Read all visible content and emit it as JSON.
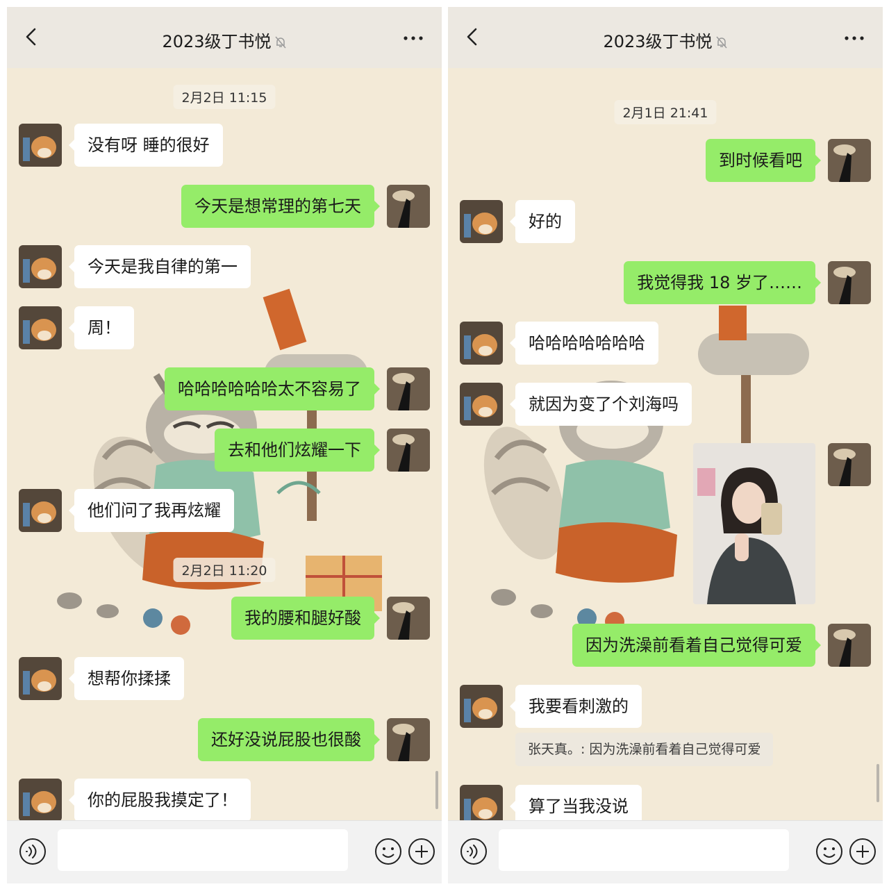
{
  "colors": {
    "chat_background": "#f3ead7",
    "header_background": "#ece8e1",
    "sent_bubble": "#95ec69",
    "received_bubble": "#ffffff"
  },
  "icons": {
    "back": "chevron-left-icon",
    "muted": "bell-slash-icon",
    "more": "ellipsis-icon",
    "voice": "voice-input-icon",
    "emoji": "emoji-icon",
    "plus": "plus-circle-icon"
  },
  "left": {
    "header": {
      "title": "2023级丁书悦"
    },
    "messages": [
      {
        "kind": "time",
        "text": "2月2日 11:15"
      },
      {
        "kind": "in",
        "text": "没有呀 睡的很好"
      },
      {
        "kind": "out",
        "text": "今天是想常理的第七天"
      },
      {
        "kind": "in",
        "text": "今天是我自律的第一"
      },
      {
        "kind": "in",
        "text": "周！"
      },
      {
        "kind": "out",
        "text": "哈哈哈哈哈哈太不容易了"
      },
      {
        "kind": "out",
        "text": "去和他们炫耀一下"
      },
      {
        "kind": "in",
        "text": "他们问了我再炫耀"
      },
      {
        "kind": "time",
        "text": "2月2日 11:20"
      },
      {
        "kind": "out",
        "text": "我的腰和腿好酸"
      },
      {
        "kind": "in",
        "text": "想帮你揉揉"
      },
      {
        "kind": "out",
        "text": "还好没说屁股也很酸"
      },
      {
        "kind": "in",
        "text": "你的屁股我摸定了！"
      }
    ]
  },
  "right": {
    "header": {
      "title": "2023级丁书悦"
    },
    "messages": [
      {
        "kind": "time",
        "text": "2月1日 21:41"
      },
      {
        "kind": "out",
        "text": "到时候看吧"
      },
      {
        "kind": "in",
        "text": "好的"
      },
      {
        "kind": "out",
        "text": "我觉得我 18 岁了……"
      },
      {
        "kind": "in",
        "text": "哈哈哈哈哈哈哈"
      },
      {
        "kind": "in",
        "text": "就因为变了个刘海吗"
      },
      {
        "kind": "out_image",
        "text": ""
      },
      {
        "kind": "out",
        "text": "因为洗澡前看着自己觉得可爱"
      },
      {
        "kind": "in",
        "text": "我要看刺激的"
      },
      {
        "kind": "quote",
        "text": "张天真。: 因为洗澡前看着自己觉得可爱"
      },
      {
        "kind": "in",
        "text": "算了当我没说"
      }
    ]
  }
}
